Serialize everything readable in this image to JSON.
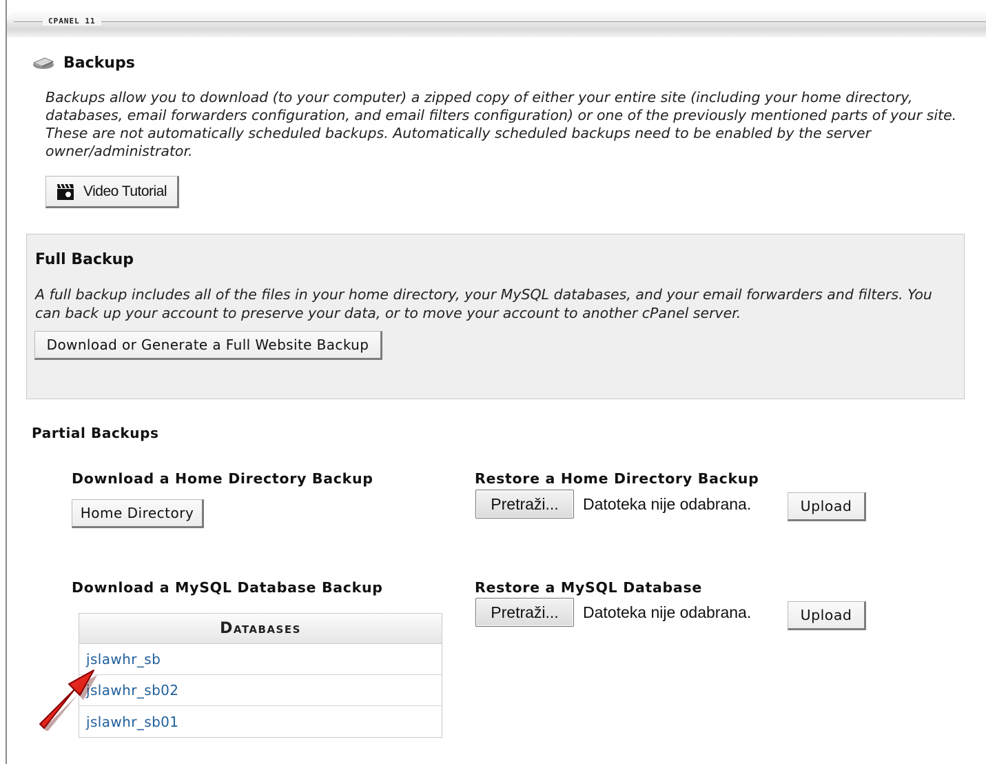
{
  "header": {
    "brand_label": "CPANEL 11"
  },
  "page": {
    "title": "Backups",
    "intro": "Backups allow you to download (to your computer) a zipped copy of either your entire site (including your home directory, databases, email forwarders configuration, and email filters configuration) or one of the previously mentioned parts of your site. These are not automatically scheduled backups. Automatically scheduled backups need to be enabled by the server owner/administrator.",
    "video_tutorial_label": "Video Tutorial"
  },
  "full_backup": {
    "title": "Full Backup",
    "description": "A full backup includes all of the files in your home directory, your MySQL databases, and your email forwarders and filters. You can back up your account to preserve your data, or to move your account to another cPanel server.",
    "button_label": "Download or Generate a Full Website Backup"
  },
  "partial": {
    "title": "Partial Backups",
    "home_download": {
      "title": "Download a Home Directory Backup",
      "button_label": "Home Directory"
    },
    "home_restore": {
      "title": "Restore a Home Directory Backup",
      "browse_label": "Pretraži...",
      "file_status": "Datoteka nije odabrana.",
      "upload_label": "Upload"
    },
    "mysql_download": {
      "title": "Download a MySQL Database Backup",
      "table_header": "Databases",
      "databases": [
        "jslawhr_sb",
        "jslawhr_sb02",
        "jslawhr_sb01"
      ]
    },
    "mysql_restore": {
      "title": "Restore a MySQL Database",
      "browse_label": "Pretraži...",
      "file_status": "Datoteka nije odabrana.",
      "upload_label": "Upload"
    }
  },
  "colors": {
    "link": "#1f5f9a",
    "panel_bg": "#efefef",
    "annotation_arrow": "#e01010"
  },
  "icons": {
    "title_icon": "disk-icon",
    "video_icon": "clapperboard-icon",
    "annotation": "red-arrow-icon"
  }
}
